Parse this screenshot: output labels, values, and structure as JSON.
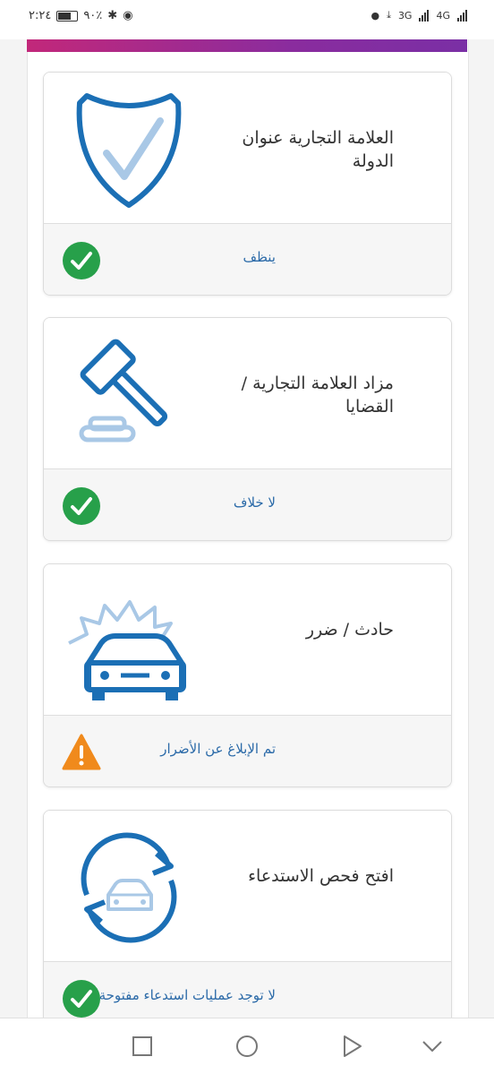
{
  "status_bar": {
    "time": "٢:٢٤",
    "battery": "٩٠٪",
    "net_3g": "3G",
    "net_4g": "4G"
  },
  "accent_colors": {
    "brand_gradient": [
      "#c2287a",
      "#7a2fa5"
    ],
    "icon_blue": "#1b6fb5",
    "icon_light_blue": "#a9c8e6",
    "ok_green": "#27a04a",
    "warn_orange": "#f08a1c",
    "status_text": "#2b6aa8"
  },
  "cards": [
    {
      "title": "العلامة التجارية عنوان الدولة",
      "icon": "shield-check-icon",
      "status": "ينظف",
      "status_icon": "check-circle-icon"
    },
    {
      "title": "مزاد العلامة التجارية / القضايا",
      "icon": "gavel-icon",
      "status": "لا خلاف",
      "status_icon": "check-circle-icon"
    },
    {
      "title": "حادث / ضرر",
      "icon": "car-crash-icon",
      "status": "تم الإبلاغ عن الأضرار",
      "status_icon": "warning-triangle-icon"
    },
    {
      "title": "افتح فحص الاستدعاء",
      "icon": "recall-cycle-icon",
      "status": "لا توجد عمليات استدعاء مفتوحة",
      "status_icon": "check-circle-icon"
    }
  ],
  "nav_bar": {
    "buttons": [
      "recent-apps-icon",
      "home-icon",
      "back-icon",
      "collapse-icon"
    ]
  }
}
